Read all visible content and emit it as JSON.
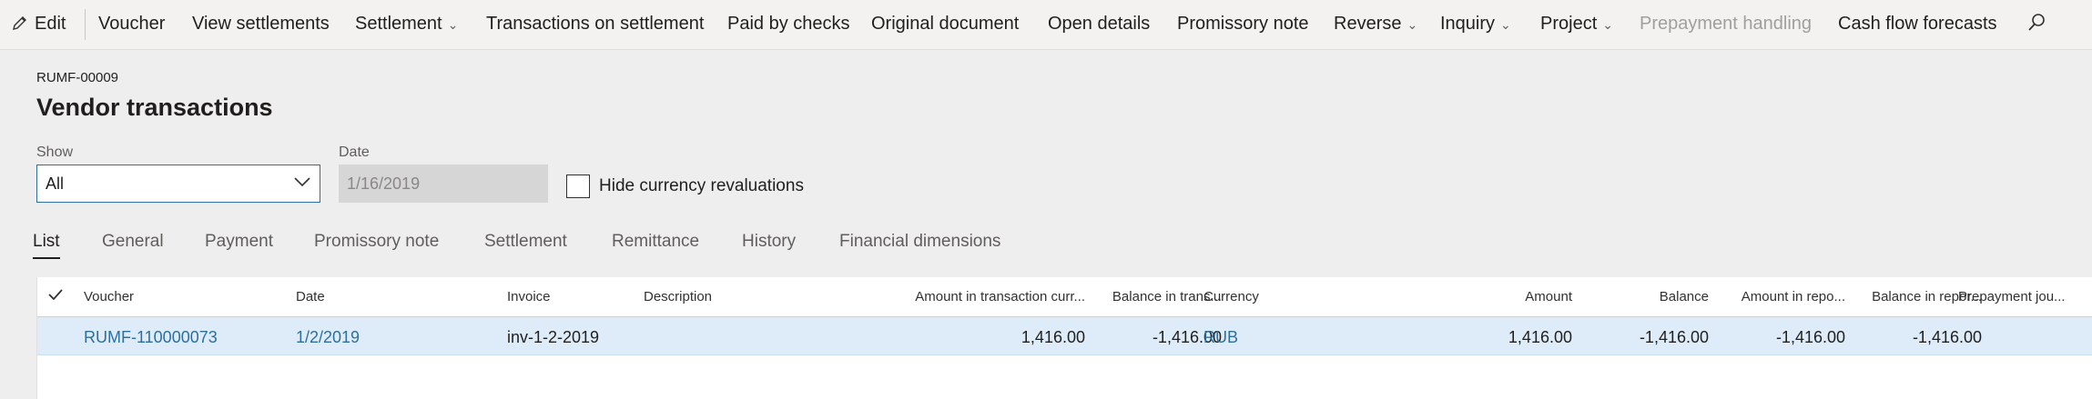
{
  "action_bar": {
    "edit": "Edit",
    "voucher": "Voucher",
    "view_settlements": "View settlements",
    "settlement": "Settlement",
    "transactions_on_settlement": "Transactions on settlement",
    "paid_by_checks": "Paid by checks",
    "original_document": "Original document",
    "open_details": "Open details",
    "promissory_note": "Promissory note",
    "reverse": "Reverse",
    "inquiry": "Inquiry",
    "project": "Project",
    "prepayment_handling": "Prepayment handling",
    "cash_flow_forecasts": "Cash flow forecasts",
    "icons": {
      "edit": "pencil-icon",
      "search": "search-icon",
      "chevron": "chevron-down-icon"
    }
  },
  "page": {
    "record_id": "RUMF-00009",
    "title": "Vendor transactions"
  },
  "filters": {
    "show_label": "Show",
    "show_value": "All",
    "date_label": "Date",
    "date_value": "1/16/2019",
    "hide_currency_revaluations": "Hide currency revaluations",
    "hide_currency_revaluations_checked": false
  },
  "tabs": [
    "List",
    "General",
    "Payment",
    "Promissory note",
    "Settlement",
    "Remittance",
    "History",
    "Financial dimensions"
  ],
  "active_tab": "List",
  "grid": {
    "columns": {
      "voucher": "Voucher",
      "date": "Date",
      "invoice": "Invoice",
      "description": "Description",
      "amount_tx": "Amount in transaction curr...",
      "balance_tx": "Balance in trans...",
      "currency": "Currency",
      "amount": "Amount",
      "balance": "Balance",
      "amount_rep": "Amount in repo...",
      "balance_rep": "Balance in repor...",
      "prepayment": "Prepayment jou..."
    },
    "rows": [
      {
        "voucher": "RUMF-110000073",
        "date": "1/2/2019",
        "invoice": "inv-1-2-2019",
        "description": "",
        "amount_tx": "1,416.00",
        "balance_tx": "-1,416.00",
        "currency": "RUB",
        "amount": "1,416.00",
        "balance": "-1,416.00",
        "amount_rep": "-1,416.00",
        "balance_rep": "-1,416.00",
        "prepayment": ""
      }
    ]
  },
  "colors": {
    "link": "#2e6f9e",
    "selected_row": "#deecf9",
    "page_bg": "#eeeeee"
  }
}
